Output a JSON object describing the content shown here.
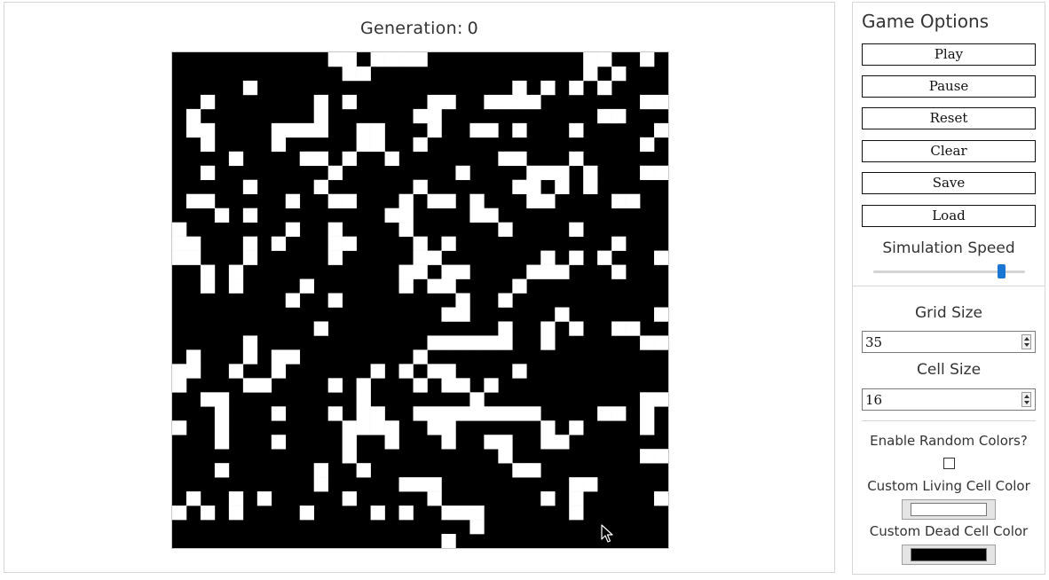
{
  "board": {
    "generation_label": "Generation:",
    "generation_value": "0",
    "rows": [
      "00000000000110111100000000000110010",
      "00000000000011000000000000000101000",
      "00000100000000000000000010101010000",
      "00100000001010000011001111000000011",
      "01000000001000000110000000000011000",
      "01100001111001100010011010001000001",
      "00100001000001100100000000000000010",
      "00001000011010010000000110001000000",
      "00100000000100000000100001110100011",
      "00000100001000000100000011010100000",
      "01100000100110001011010001100001100",
      "00010100000000011000011000000000000",
      "10000000100100001000000100001000000",
      "11000101000110000101000000000001000",
      "11000100000100000110000000101010001",
      "00101000000000001101100001110001000",
      "00101000010000001011000010000000000",
      "00000000100100000000100100000000000",
      "00000000000000000001100000010000001",
      "00000000001000000000000100101001100",
      "00000100000000000011111100100000011",
      "01000101100000000100000000000000000",
      "11001001000000101011000010000000000",
      "10000110000101000101101000000000000",
      "00110000000001000000010000000000011",
      "00010001000101100111111111000011010",
      "10010000000011110011000000101000010",
      "00010001000010010001001100110000000",
      "00000000000010000000000100000000011",
      "00010000001001000000000011000000000",
      "00000000001000001110000000001100000",
      "01001010000010000010000000101000001",
      "10101000010000101001110000001000000",
      "00000000000000000000010000000000000",
      "00000000000000000001000000000000000"
    ]
  },
  "options": {
    "title": "Game Options",
    "buttons": {
      "play": "Play",
      "pause": "Pause",
      "reset": "Reset",
      "clear": "Clear",
      "save": "Save",
      "load": "Load"
    },
    "simulation_speed": {
      "label": "Simulation Speed",
      "level_fraction": 0.85
    },
    "grid_size": {
      "label": "Grid Size",
      "value": "35"
    },
    "cell_size": {
      "label": "Cell Size",
      "value": "16"
    },
    "random_colors": {
      "label": "Enable Random Colors?",
      "checked": false
    },
    "living_cell_color": {
      "label": "Custom Living Cell Color",
      "value": "#ffffff"
    },
    "dead_cell_color": {
      "label": "Custom Dead Cell Color",
      "value": "#000000"
    }
  },
  "colors": {
    "accent": "#1976d2",
    "border": "#d6d6d6"
  },
  "icons": {
    "cursor": "mouse-pointer-icon"
  }
}
